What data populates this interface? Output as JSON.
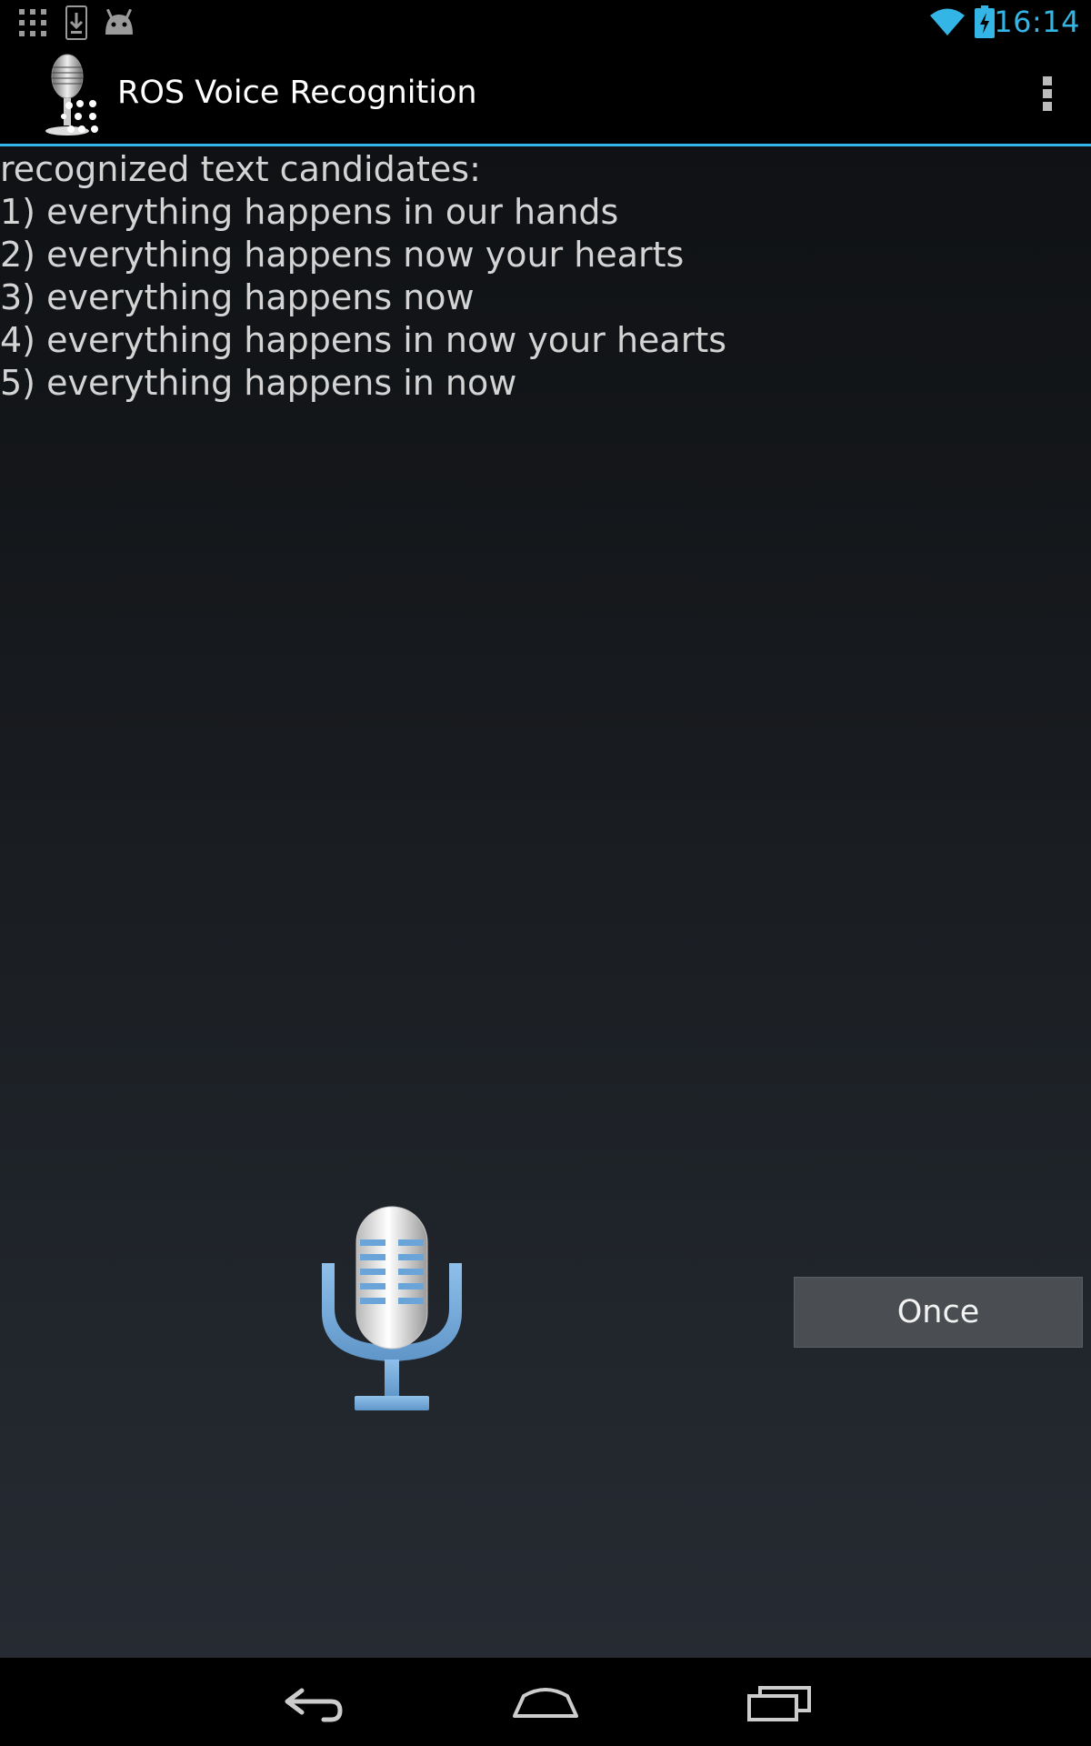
{
  "status_bar": {
    "time": "16:14",
    "icons": [
      "apps-grid-icon",
      "download-icon",
      "android-icon",
      "wifi-icon",
      "battery-charging-icon"
    ]
  },
  "action_bar": {
    "title": "ROS Voice Recognition",
    "app_icon": "microphone-app-icon",
    "overflow_icon": "overflow-menu-icon"
  },
  "results": {
    "heading": "recognized text candidates:",
    "candidates": [
      "1) everything happens in our hands",
      "2) everything happens now your hearts",
      "3) everything happens now",
      "4) everything happens in now your hearts",
      "5) everything happens in now"
    ]
  },
  "controls": {
    "mic_icon": "microphone-icon",
    "once_label": "Once"
  },
  "nav_bar": {
    "icons": [
      "back-icon",
      "home-icon",
      "recent-apps-icon"
    ]
  },
  "colors": {
    "accent": "#33b5e5",
    "text": "#d4d4d4",
    "button": "#4a4d51"
  }
}
